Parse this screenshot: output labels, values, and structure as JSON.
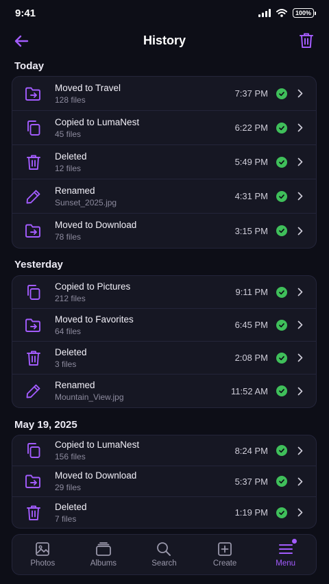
{
  "status": {
    "time": "9:41",
    "battery": "100%"
  },
  "header": {
    "title": "History"
  },
  "colors": {
    "accent": "#a35cff",
    "success": "#3fbf5a",
    "background": "#0d0e17",
    "card": "#161723"
  },
  "sections": [
    {
      "title": "Today",
      "items": [
        {
          "icon": "folder-move-icon",
          "title": "Moved to Travel",
          "sub": "128 files",
          "time": "7:37 PM"
        },
        {
          "icon": "copy-icon",
          "title": "Copied to LumaNest",
          "sub": "45 files",
          "time": "6:22 PM"
        },
        {
          "icon": "trash-icon",
          "title": "Deleted",
          "sub": "12 files",
          "time": "5:49 PM"
        },
        {
          "icon": "pencil-icon",
          "title": "Renamed",
          "sub": "Sunset_2025.jpg",
          "time": "4:31 PM"
        },
        {
          "icon": "folder-move-icon",
          "title": "Moved to Download",
          "sub": "78 files",
          "time": "3:15 PM"
        }
      ]
    },
    {
      "title": "Yesterday",
      "items": [
        {
          "icon": "copy-icon",
          "title": "Copied to Pictures",
          "sub": "212 files",
          "time": "9:11 PM"
        },
        {
          "icon": "folder-move-icon",
          "title": "Moved to Favorites",
          "sub": "64 files",
          "time": "6:45 PM"
        },
        {
          "icon": "trash-icon",
          "title": "Deleted",
          "sub": "3 files",
          "time": "2:08 PM"
        },
        {
          "icon": "pencil-icon",
          "title": "Renamed",
          "sub": "Mountain_View.jpg",
          "time": "11:52 AM"
        }
      ]
    },
    {
      "title": "May 19, 2025",
      "items": [
        {
          "icon": "copy-icon",
          "title": "Copied to LumaNest",
          "sub": "156 files",
          "time": "8:24 PM"
        },
        {
          "icon": "folder-move-icon",
          "title": "Moved to Download",
          "sub": "29 files",
          "time": "5:37 PM"
        },
        {
          "icon": "trash-icon",
          "title": "Deleted",
          "sub": "7 files",
          "time": "1:19 PM"
        }
      ]
    }
  ],
  "tabs": [
    {
      "label": "Photos",
      "icon": "photos-icon"
    },
    {
      "label": "Albums",
      "icon": "albums-icon"
    },
    {
      "label": "Search",
      "icon": "search-icon"
    },
    {
      "label": "Create",
      "icon": "create-icon"
    },
    {
      "label": "Menu",
      "icon": "menu-icon",
      "active": true
    }
  ]
}
